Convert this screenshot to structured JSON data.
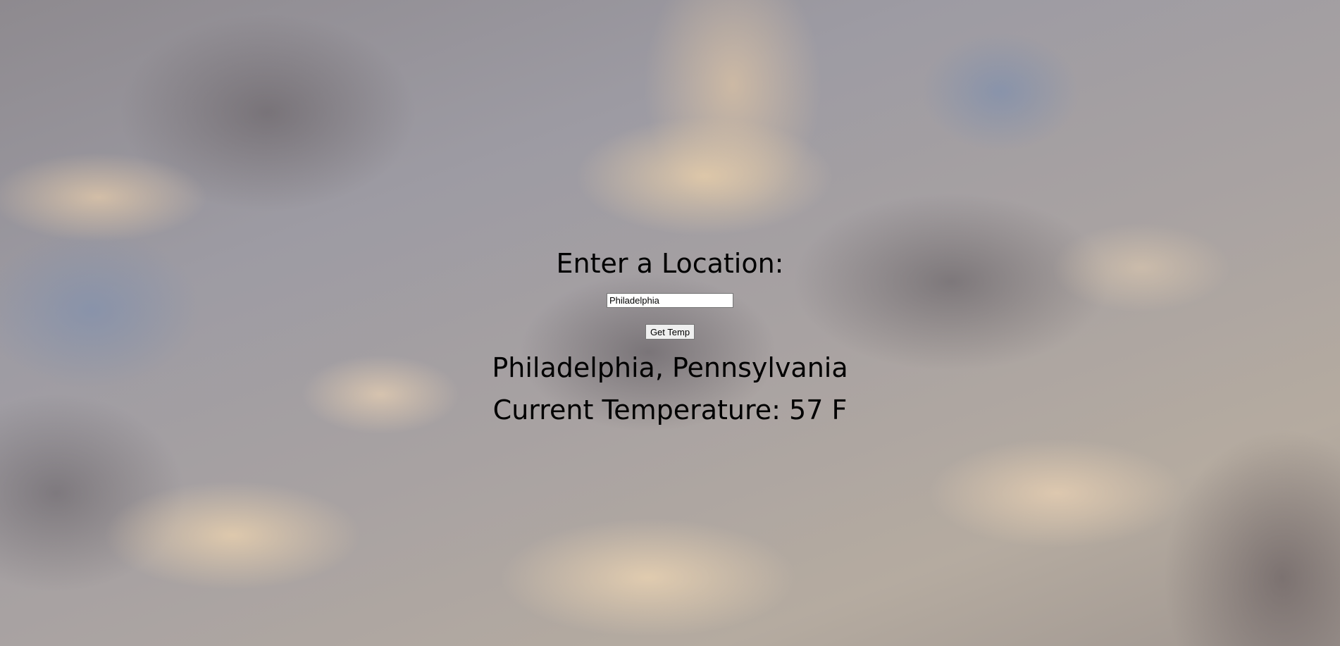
{
  "form": {
    "heading": "Enter a Location:",
    "input_value": "Philadelphia",
    "button_label": "Get Temp"
  },
  "result": {
    "place": "Philadelphia, Pennsylvania",
    "temperature": "Current Temperature: 57 F"
  }
}
